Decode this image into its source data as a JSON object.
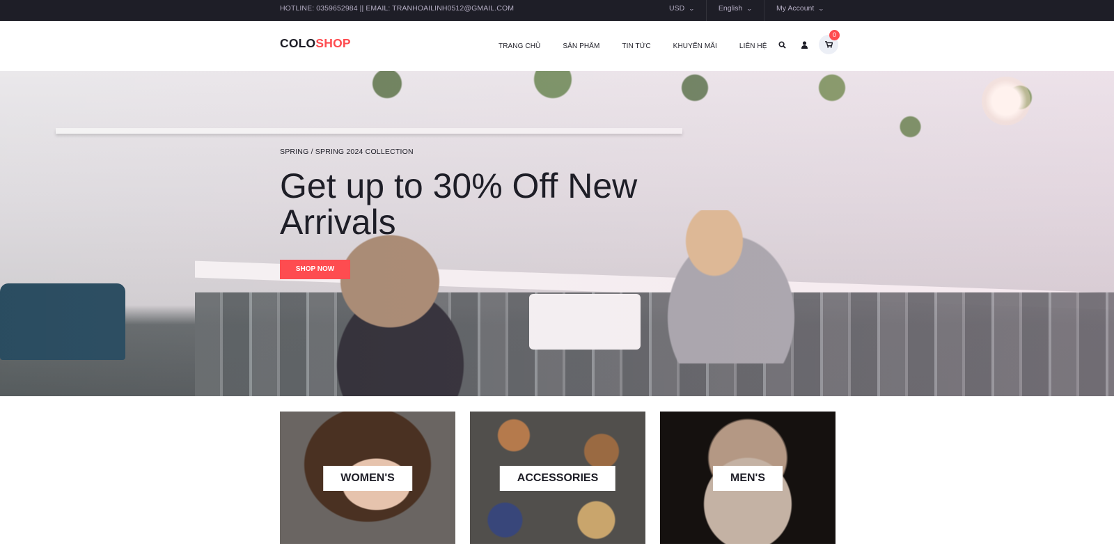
{
  "topbar": {
    "hotline": "HOTLINE: 0359652984 || EMAIL: TRANHOAILINH0512@GMAIL.COM",
    "currency": "USD",
    "language": "English",
    "account": "My Account"
  },
  "header": {
    "logo_part1": "COLO",
    "logo_part2": "SHOP",
    "nav": [
      "TRANG CHỦ",
      "SẢN PHẨM",
      "TIN TỨC",
      "KHUYẾN MÃI",
      "LIÊN HỆ"
    ],
    "cart_count": "0"
  },
  "hero": {
    "subtitle": "SPRING / SPRING 2024 COLLECTION",
    "title": "Get up to 30% Off New Arrivals",
    "button": "SHOP NOW"
  },
  "banners": [
    {
      "label": "WOMEN'S"
    },
    {
      "label": "ACCESSORIES"
    },
    {
      "label": "MEN'S"
    }
  ],
  "colors": {
    "accent": "#fe4c50",
    "dark": "#1e1e27"
  },
  "icons": [
    "search-icon",
    "user-icon",
    "cart-icon",
    "chevron-down-icon"
  ]
}
